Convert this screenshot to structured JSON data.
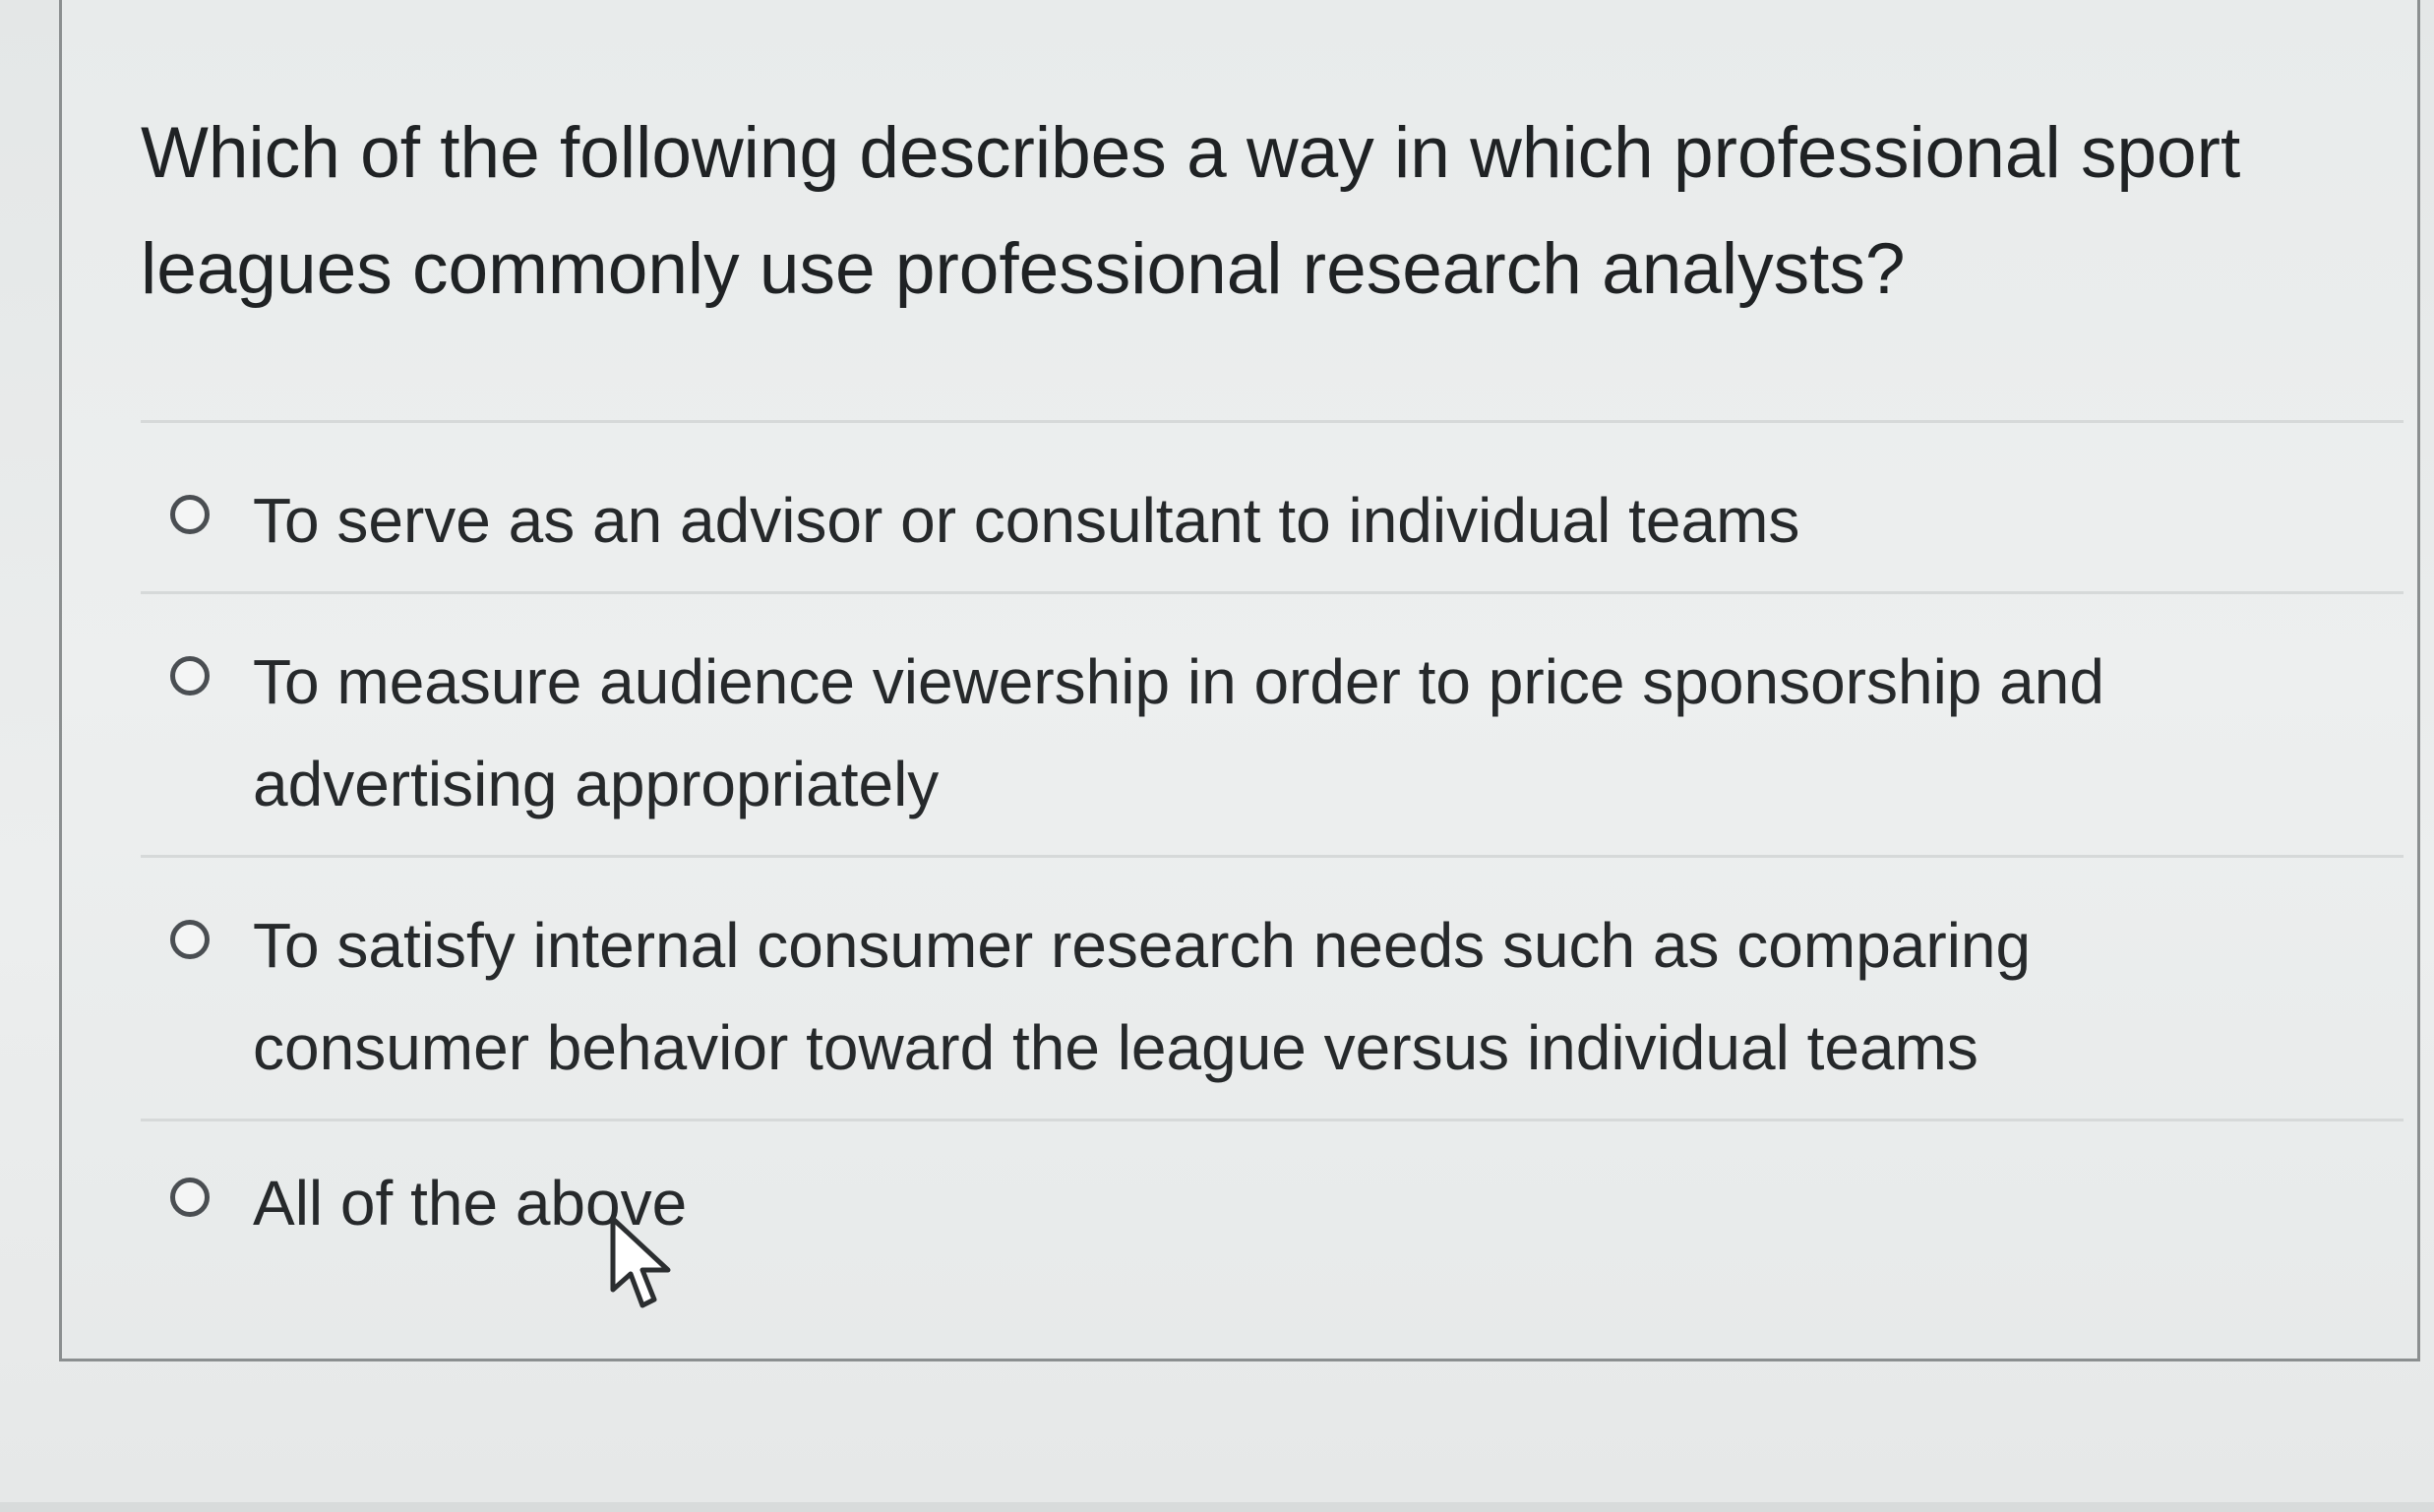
{
  "question": {
    "text": "Which of the following describes a way in which professional sport leagues commonly use professional research analysts?"
  },
  "options": [
    {
      "label": "To serve as an advisor or consultant to individual teams",
      "selected": false
    },
    {
      "label": "To measure audience viewership in order to price sponsorship and advertising appropriately",
      "selected": false
    },
    {
      "label": "To satisfy internal consumer research needs such as comparing consumer behavior toward the league versus individual teams",
      "selected": false
    },
    {
      "label": "All of the above",
      "selected": false
    }
  ],
  "icons": {
    "radio": "radio-unchecked-icon",
    "cursor": "mouse-pointer-icon"
  },
  "colors": {
    "text": "#1f2224",
    "border": "#8b8f90",
    "background": "#e9ecec"
  }
}
